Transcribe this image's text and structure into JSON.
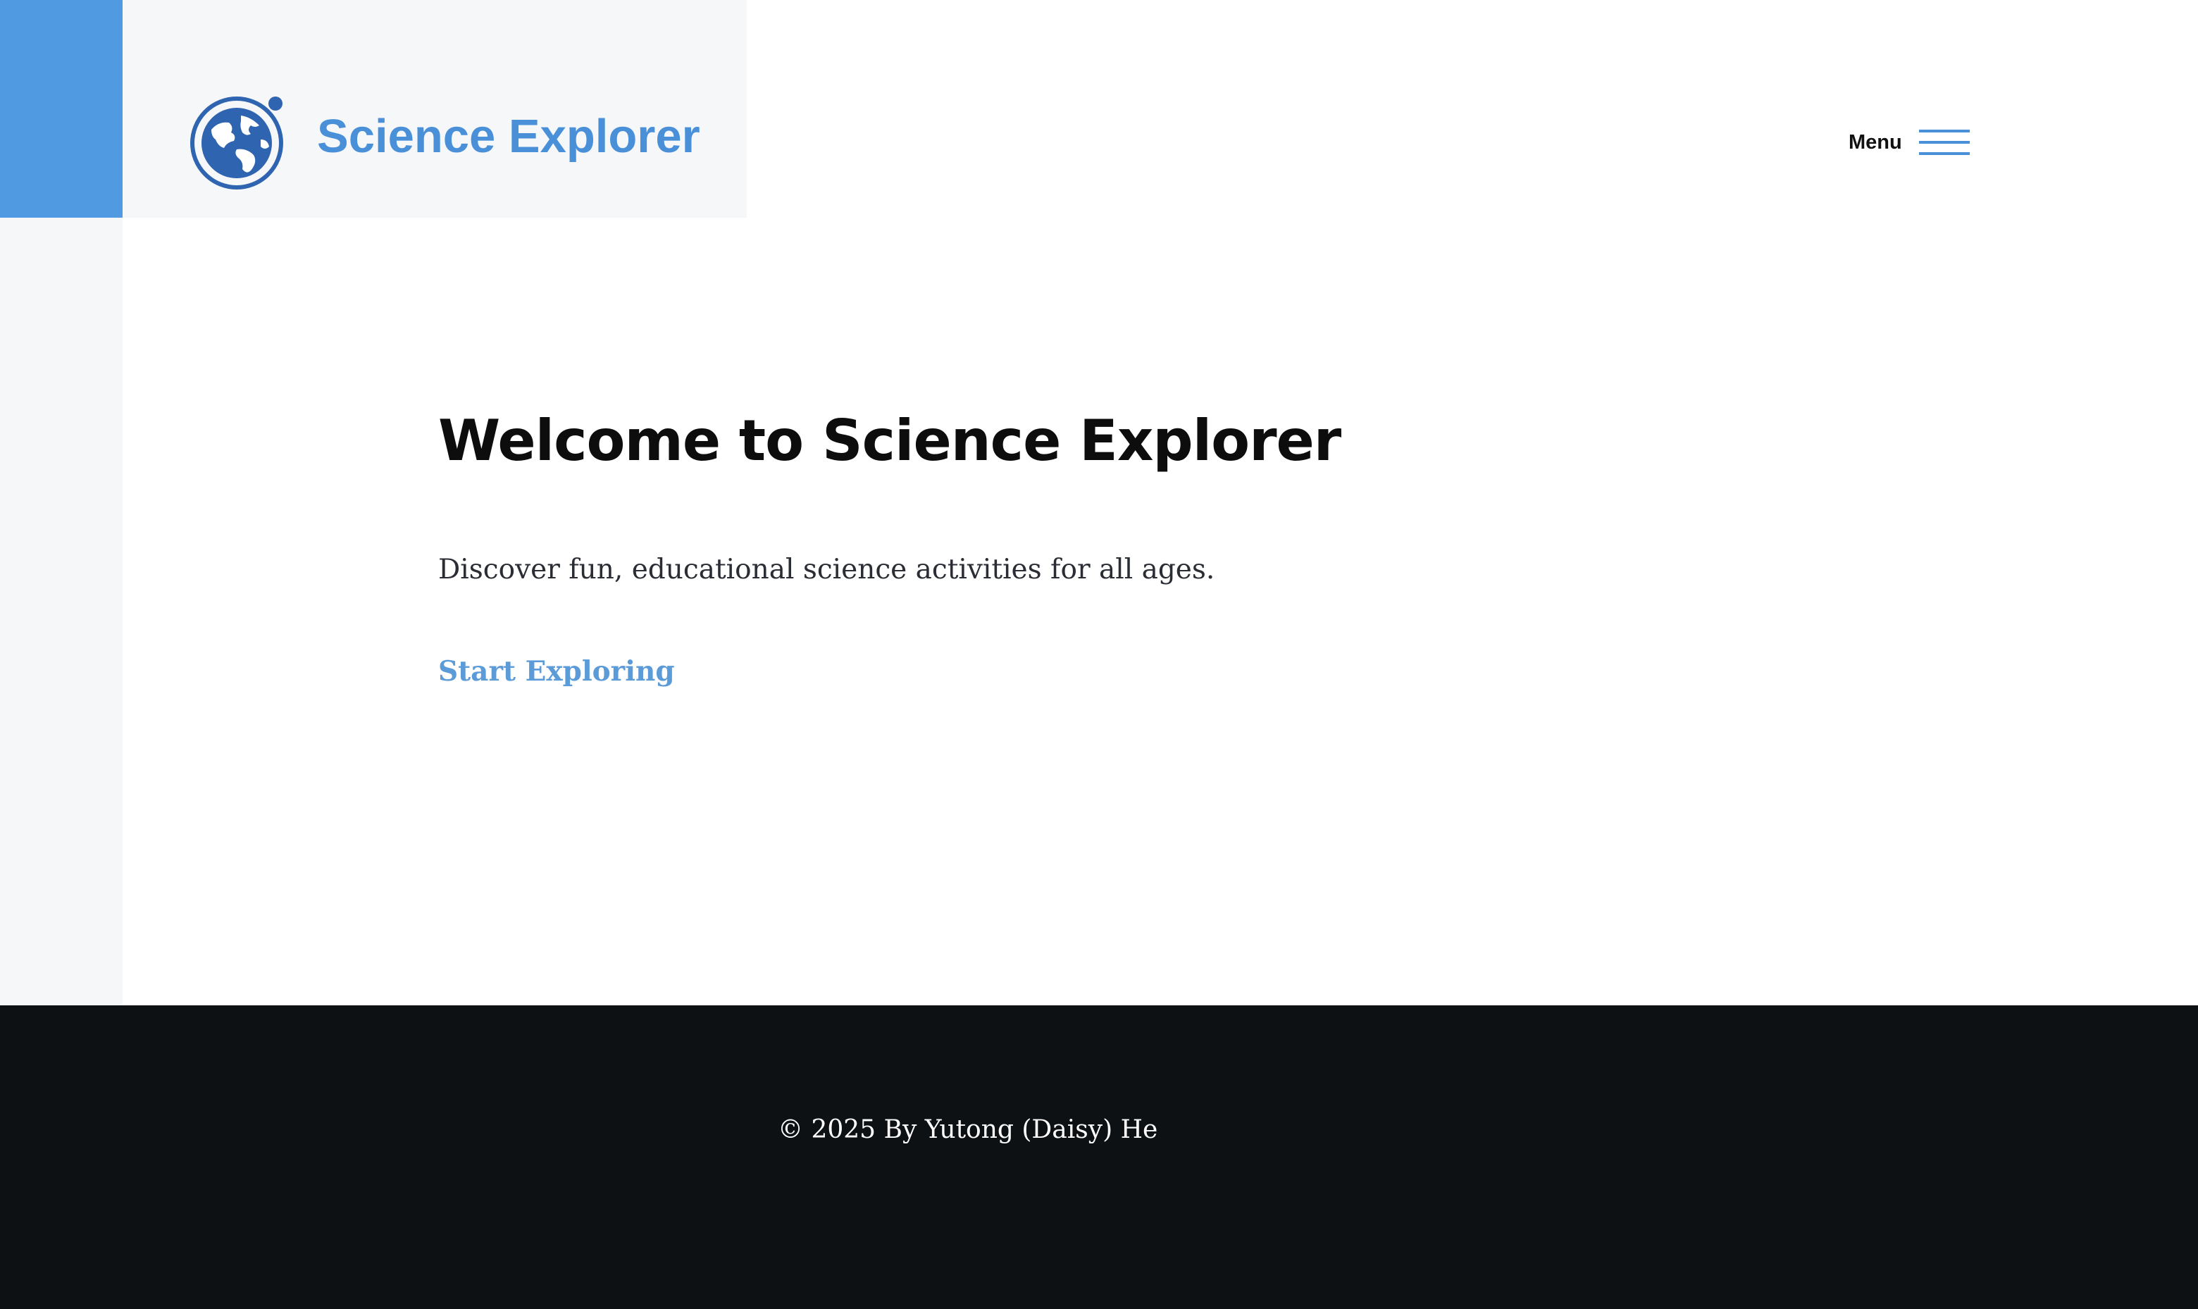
{
  "header": {
    "brand_name": "Science Explorer",
    "logo_icon": "globe-orbit-icon",
    "menu_label": "Menu",
    "menu_icon": "hamburger-icon"
  },
  "hero": {
    "title": "Welcome to Science Explorer",
    "description": "Discover fun, educational science activities for all ages.",
    "cta_label": "Start Exploring"
  },
  "footer": {
    "copyright": "© 2025 By Yutong (Daisy) He"
  },
  "colors": {
    "accent": "#4f9ae0",
    "brand_text": "#4a90d9",
    "link": "#5b9bd8",
    "footer_bg": "#0e1114",
    "side_panel": "#f6f7f9"
  }
}
